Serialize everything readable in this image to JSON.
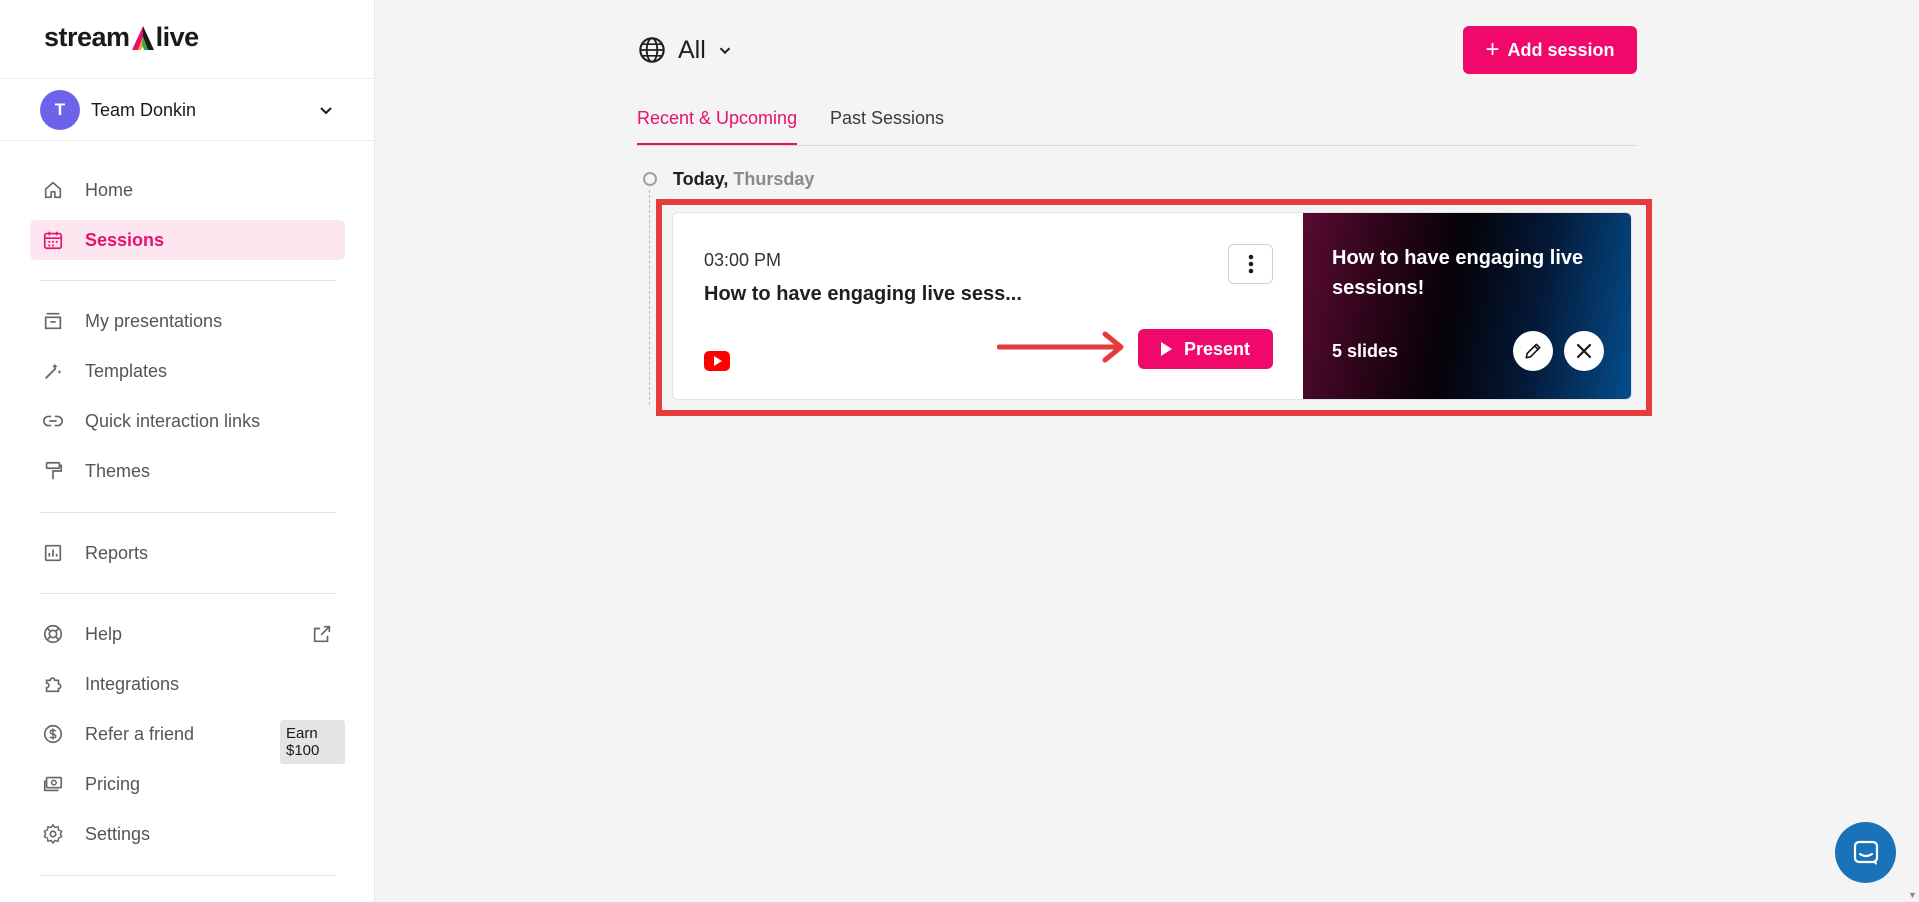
{
  "app": {
    "logo_left": "stream",
    "logo_right": "live"
  },
  "team": {
    "avatar_letter": "T",
    "name": "Team Donkin"
  },
  "nav": {
    "home": "Home",
    "sessions": "Sessions",
    "my_presentations": "My presentations",
    "templates": "Templates",
    "quick_links": "Quick interaction links",
    "themes": "Themes",
    "reports": "Reports",
    "help": "Help",
    "integrations": "Integrations",
    "refer": "Refer a friend",
    "refer_badge": "Earn $100",
    "pricing": "Pricing",
    "settings": "Settings"
  },
  "header": {
    "filter_label": "All",
    "add_session_label": "Add session"
  },
  "tabs": {
    "recent": "Recent & Upcoming",
    "past": "Past Sessions"
  },
  "timeline": {
    "day": "Today,",
    "weekday": "Thursday"
  },
  "session": {
    "time": "03:00 PM",
    "title": "How to have engaging live sess...",
    "present_label": "Present",
    "platform_icon": "youtube-icon",
    "thumbnail_title": "How to have engaging live sessions!",
    "slides": "5 slides"
  },
  "colors": {
    "accent": "#f0086b",
    "highlight": "#e53b3b",
    "avatar": "#6c63e8",
    "chat": "#1a73b8"
  }
}
